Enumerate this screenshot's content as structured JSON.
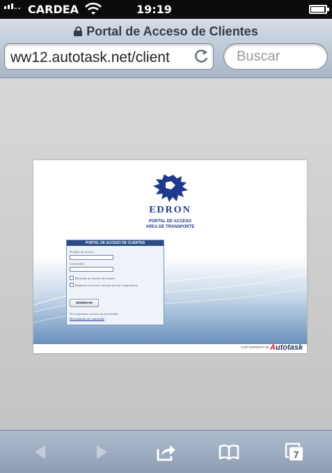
{
  "status_bar": {
    "carrier": "CARDEA",
    "time": "19:19",
    "signal_icon": "signal-icon",
    "wifi_icon": "wifi-icon",
    "battery_icon": "battery-charging-icon"
  },
  "browser": {
    "page_title": "Portal de Acceso de Clientes",
    "url": "ww12.autotask.net/client",
    "search_placeholder": "Buscar",
    "lock_icon": "lock-icon",
    "reload_icon": "reload-icon"
  },
  "webpage": {
    "brand_name": "EDRON",
    "tagline_line1": "PORTAL DE ACCESO",
    "tagline_line2": "AREA DE TRANSPORTE",
    "login_title": "PORTAL DE ACCESO DE CLIENTES",
    "username_label": "Nombre de usuario:",
    "password_label": "Contraseña:",
    "remember_label": "Recordar mi nombre de usuario",
    "keep_signed_label": "Mantener mi acceso iniciado en esta computadora",
    "login_button": "INGRESAR",
    "notice": "No se permiten accesos no autorizados.",
    "forgot_link": "Reconfigurar mi contraseña",
    "powered_by": "CON SOPORTE DE",
    "powered_brand_a": "A",
    "powered_brand_b": "utotask"
  },
  "toolbar": {
    "tabs_count": "7",
    "icons": [
      "back-icon",
      "forward-icon",
      "share-icon",
      "bookmarks-icon",
      "tabs-icon"
    ]
  },
  "colors": {
    "brand_blue": "#1f3a8c",
    "login_header": "#2b4c86",
    "autotask_red": "#d6141c"
  }
}
